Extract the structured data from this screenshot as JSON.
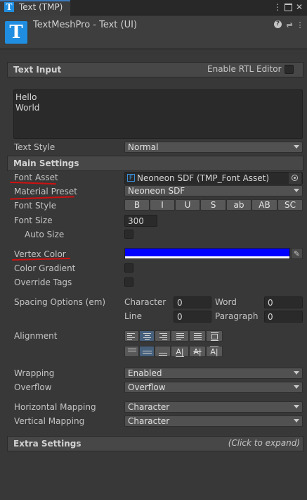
{
  "window": {
    "tab_title": "Text (TMP)",
    "tab_icon": "T"
  },
  "component": {
    "icon": "T",
    "title": "TextMeshPro - Text (UI)"
  },
  "text_input": {
    "header": "Text Input",
    "rtl_label": "Enable RTL Editor",
    "line1": "Hello",
    "line2": "World",
    "style_label": "Text Style",
    "style_value": "Normal"
  },
  "main_settings": {
    "header": "Main Settings",
    "font_asset_label": "Font Asset",
    "font_asset_value": "Neoneon SDF (TMP_Font Asset)",
    "material_preset_label": "Material Preset",
    "material_preset_value": "Neoneon SDF",
    "font_style_label": "Font Style",
    "font_style_buttons": [
      "B",
      "I",
      "U",
      "S",
      "ab",
      "AB",
      "SC"
    ],
    "font_size_label": "Font Size",
    "font_size_value": "300",
    "auto_size_label": "Auto Size",
    "vertex_color_label": "Vertex Color",
    "vertex_color": "#0000ff",
    "color_gradient_label": "Color Gradient",
    "override_tags_label": "Override Tags",
    "spacing_label": "Spacing Options (em)",
    "character_label": "Character",
    "character_value": "0",
    "word_label": "Word",
    "word_value": "0",
    "line_label": "Line",
    "line_value": "0",
    "paragraph_label": "Paragraph",
    "paragraph_value": "0",
    "alignment_label": "Alignment",
    "wrapping_label": "Wrapping",
    "wrapping_value": "Enabled",
    "overflow_label": "Overflow",
    "overflow_value": "Overflow",
    "horizontal_mapping_label": "Horizontal Mapping",
    "horizontal_mapping_value": "Character",
    "vertical_mapping_label": "Vertical Mapping",
    "vertical_mapping_value": "Character"
  },
  "extra_settings": {
    "header": "Extra Settings",
    "hint": "(Click to expand)"
  },
  "colors": {
    "accent": "#3a79bb",
    "annotation": "#d01010",
    "icon_blue": "#1f8ee0"
  }
}
